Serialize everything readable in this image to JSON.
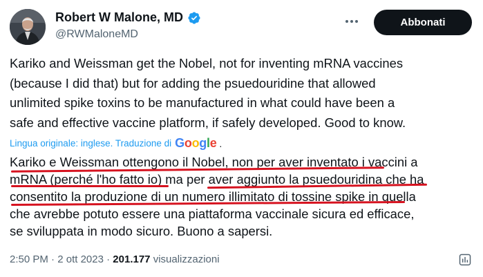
{
  "author": {
    "name": "Robert W Malone, MD",
    "handle": "@RWMaloneMD",
    "verified_color": "#1d9bf0"
  },
  "follow_button": {
    "label": "Abbonati"
  },
  "more_icon": "more-horizontal-icon",
  "tweet": {
    "lines": [
      "Kariko and Weissman get the Nobel, not for inventing mRNA vaccines",
      "(because I did that) but for adding the psuedouridine that allowed",
      "unlimited spike toxins to be manufactured in what could have been a",
      "safe and effective vaccine platform, if safely developed.  Good to know."
    ]
  },
  "translation": {
    "label": "Lingua originale: inglese. Traduzione di",
    "provider": "Google",
    "suffix": ".",
    "lines": [
      "Kariko e Weissman ottengono il Nobel, non per aver inventato i vaccini a",
      "mRNA (perché l'ho fatto io) ma per aver aggiunto la psuedouridina che ha",
      "consentito la produzione di un numero illimitato di tossine spike in quella",
      "che avrebbe potuto essere una piattaforma vaccinale sicura ed efficace,",
      "se sviluppata in modo sicuro. Buono a sapersi."
    ]
  },
  "meta": {
    "time": "2:50 PM",
    "sep1": "·",
    "date": "2 ott 2023",
    "sep2": "·",
    "views": "201.177",
    "views_label": "visualizzazioni"
  },
  "colors": {
    "underline": "#d6121f",
    "link": "#1d9bf0",
    "text": "#0f1419",
    "muted": "#536471"
  }
}
